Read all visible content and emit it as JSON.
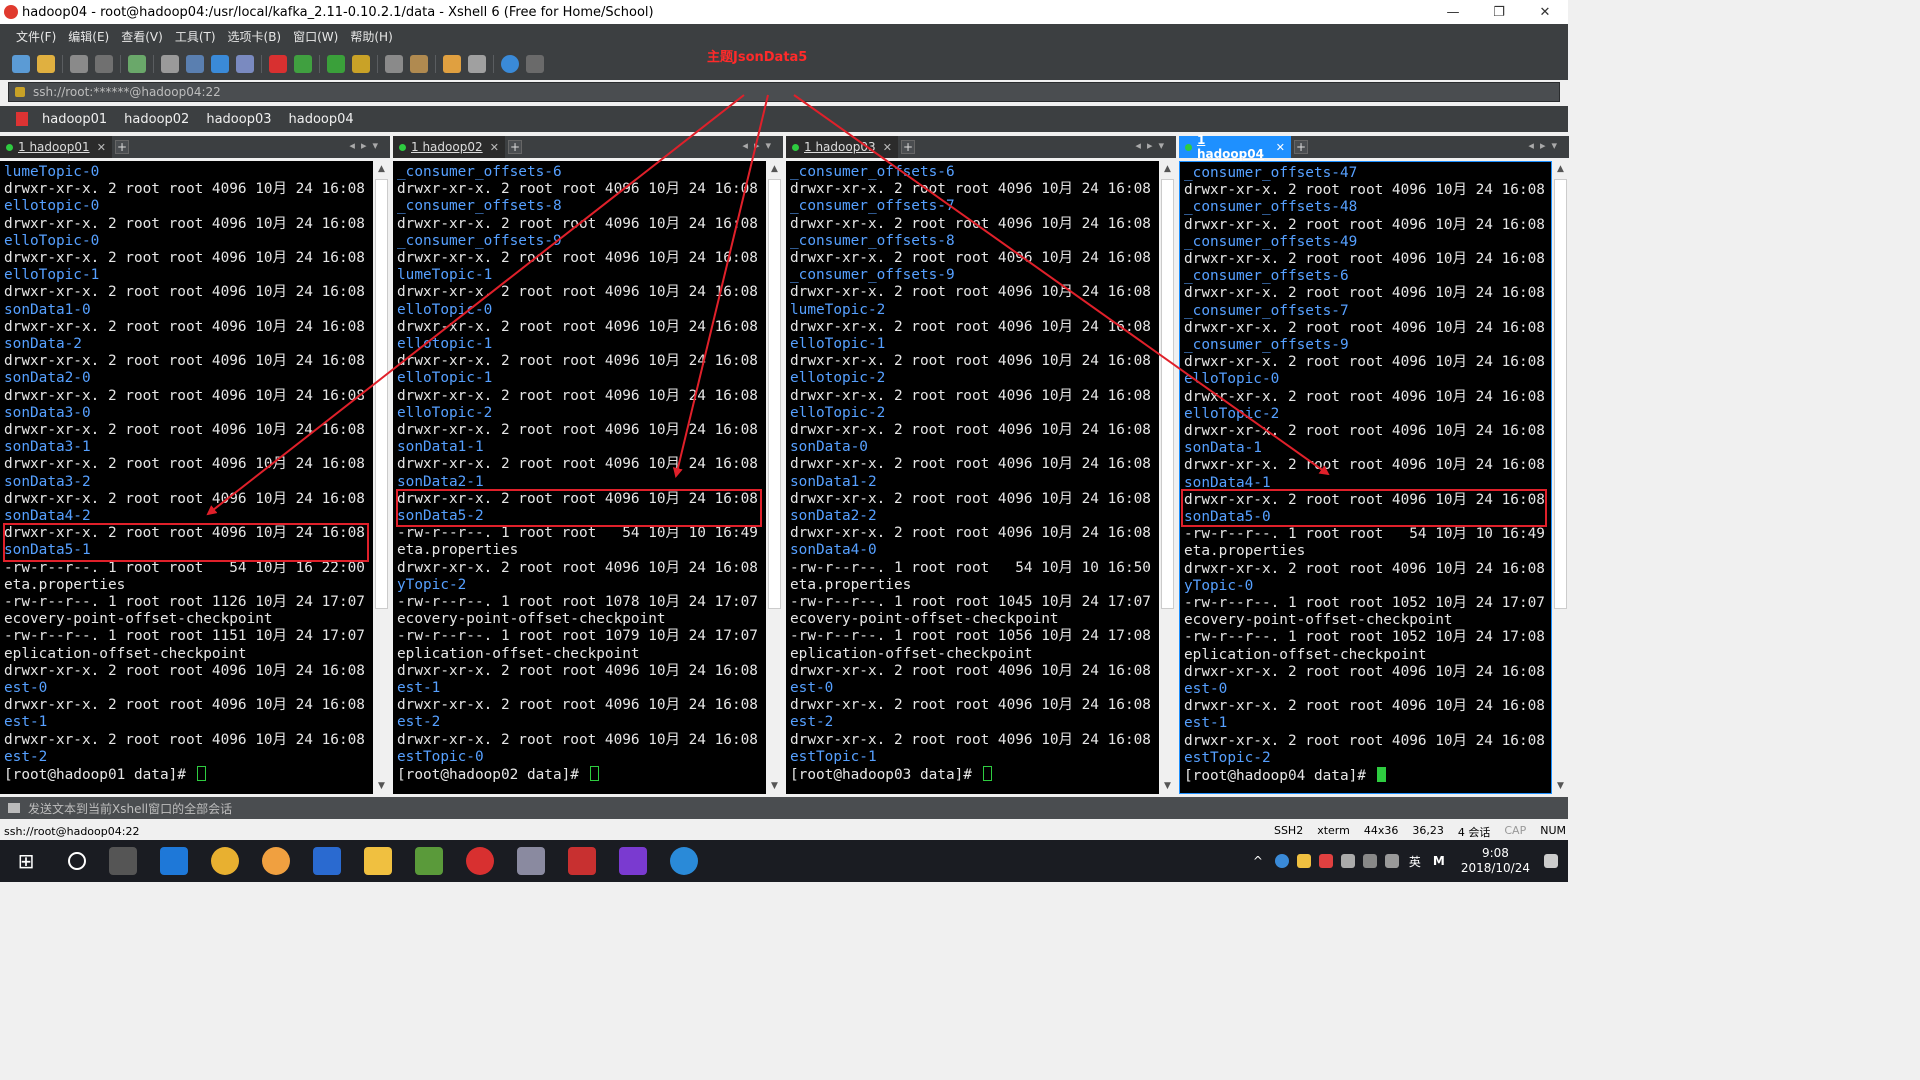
{
  "window": {
    "title": "hadoop04 - root@hadoop04:/usr/local/kafka_2.11-0.10.2.1/data - Xshell 6 (Free for Home/School)",
    "minimize": "—",
    "maximize": "❐",
    "close": "✕"
  },
  "menu": [
    "文件(F)",
    "编辑(E)",
    "查看(V)",
    "工具(T)",
    "选项卡(B)",
    "窗口(W)",
    "帮助(H)"
  ],
  "address": "ssh://root:******@hadoop04:22",
  "sessions": [
    "hadoop01",
    "hadoop02",
    "hadoop03",
    "hadoop04"
  ],
  "annotation": {
    "title": "主题JsonData5",
    "color": "#ff2a2a"
  },
  "panes": [
    {
      "tab_label": "1 hadoop01",
      "active": false,
      "lines": [
        {
          "t": "lumeTopic-0",
          "c": "blue"
        },
        {
          "t": "drwxr-xr-x. 2 root root 4096 10月 24 16:08 h"
        },
        {
          "t": "ellotopic-0",
          "c": "blue"
        },
        {
          "t": "drwxr-xr-x. 2 root root 4096 10月 24 16:08 h"
        },
        {
          "t": "elloTopic-0",
          "c": "blue"
        },
        {
          "t": "drwxr-xr-x. 2 root root 4096 10月 24 16:08 h"
        },
        {
          "t": "elloTopic-1",
          "c": "blue"
        },
        {
          "t": "drwxr-xr-x. 2 root root 4096 10月 24 16:08 J"
        },
        {
          "t": "sonData1-0",
          "c": "blue"
        },
        {
          "t": "drwxr-xr-x. 2 root root 4096 10月 24 16:08 J"
        },
        {
          "t": "sonData-2",
          "c": "blue"
        },
        {
          "t": "drwxr-xr-x. 2 root root 4096 10月 24 16:08 J"
        },
        {
          "t": "sonData2-0",
          "c": "blue"
        },
        {
          "t": "drwxr-xr-x. 2 root root 4096 10月 24 16:08 J"
        },
        {
          "t": "sonData3-0",
          "c": "blue"
        },
        {
          "t": "drwxr-xr-x. 2 root root 4096 10月 24 16:08 J"
        },
        {
          "t": "sonData3-1",
          "c": "blue"
        },
        {
          "t": "drwxr-xr-x. 2 root root 4096 10月 24 16:08 J"
        },
        {
          "t": "sonData3-2",
          "c": "blue"
        },
        {
          "t": "drwxr-xr-x. 2 root root 4096 10月 24 16:08 J"
        },
        {
          "t": "sonData4-2",
          "c": "blue"
        },
        {
          "t": "drwxr-xr-x. 2 root root 4096 10月 24 16:08 J"
        },
        {
          "t": "sonData5-1",
          "c": "blue"
        },
        {
          "t": "-rw-r--r--. 1 root root   54 10月 16 22:00 m"
        },
        {
          "t": "eta.properties"
        },
        {
          "t": "-rw-r--r--. 1 root root 1126 10月 24 17:07 r"
        },
        {
          "t": "ecovery-point-offset-checkpoint"
        },
        {
          "t": "-rw-r--r--. 1 root root 1151 10月 24 17:07 r"
        },
        {
          "t": "eplication-offset-checkpoint"
        },
        {
          "t": "drwxr-xr-x. 2 root root 4096 10月 24 16:08 t"
        },
        {
          "t": "est-0",
          "c": "blue"
        },
        {
          "t": "drwxr-xr-x. 2 root root 4096 10月 24 16:08 t"
        },
        {
          "t": "est-1",
          "c": "blue"
        },
        {
          "t": "drwxr-xr-x. 2 root root 4096 10月 24 16:08 t"
        },
        {
          "t": "est-2",
          "c": "blue"
        }
      ],
      "prompt": "[root@hadoop01 data]# "
    },
    {
      "tab_label": "1 hadoop02",
      "active": false,
      "lines": [
        {
          "t": "_consumer_offsets-6",
          "c": "blue"
        },
        {
          "t": "drwxr-xr-x. 2 root root 4096 10月 24 16:08 _"
        },
        {
          "t": "_consumer_offsets-8",
          "c": "blue"
        },
        {
          "t": "drwxr-xr-x. 2 root root 4096 10月 24 16:08 _"
        },
        {
          "t": "_consumer_offsets-9",
          "c": "blue"
        },
        {
          "t": "drwxr-xr-x. 2 root root 4096 10月 24 16:08 f"
        },
        {
          "t": "lumeTopic-1",
          "c": "blue"
        },
        {
          "t": "drwxr-xr-x. 2 root root 4096 10月 24 16:08 h"
        },
        {
          "t": "elloTopic-0",
          "c": "blue"
        },
        {
          "t": "drwxr-xr-x. 2 root root 4096 10月 24 16:08 h"
        },
        {
          "t": "ellotopic-1",
          "c": "blue"
        },
        {
          "t": "drwxr-xr-x. 2 root root 4096 10月 24 16:08 h"
        },
        {
          "t": "elloTopic-1",
          "c": "blue"
        },
        {
          "t": "drwxr-xr-x. 2 root root 4096 10月 24 16:08 h"
        },
        {
          "t": "elloTopic-2",
          "c": "blue"
        },
        {
          "t": "drwxr-xr-x. 2 root root 4096 10月 24 16:08 J"
        },
        {
          "t": "sonData1-1",
          "c": "blue"
        },
        {
          "t": "drwxr-xr-x. 2 root root 4096 10月 24 16:08 J"
        },
        {
          "t": "sonData2-1",
          "c": "blue"
        },
        {
          "t": "drwxr-xr-x. 2 root root 4096 10月 24 16:08 J"
        },
        {
          "t": "sonData5-2",
          "c": "blue"
        },
        {
          "t": "-rw-r--r--. 1 root root   54 10月 10 16:49 m"
        },
        {
          "t": "eta.properties"
        },
        {
          "t": "drwxr-xr-x. 2 root root 4096 10月 24 16:08 m"
        },
        {
          "t": "yTopic-2",
          "c": "blue"
        },
        {
          "t": "-rw-r--r--. 1 root root 1078 10月 24 17:07 r"
        },
        {
          "t": "ecovery-point-offset-checkpoint"
        },
        {
          "t": "-rw-r--r--. 1 root root 1079 10月 24 17:07 r"
        },
        {
          "t": "eplication-offset-checkpoint"
        },
        {
          "t": "drwxr-xr-x. 2 root root 4096 10月 24 16:08 t"
        },
        {
          "t": "est-1",
          "c": "blue"
        },
        {
          "t": "drwxr-xr-x. 2 root root 4096 10月 24 16:08 t"
        },
        {
          "t": "est-2",
          "c": "blue"
        },
        {
          "t": "drwxr-xr-x. 2 root root 4096 10月 24 16:08 t"
        },
        {
          "t": "estTopic-0",
          "c": "blue"
        }
      ],
      "prompt": "[root@hadoop02 data]# "
    },
    {
      "tab_label": "1 hadoop03",
      "active": false,
      "lines": [
        {
          "t": "_consumer_offsets-6",
          "c": "blue"
        },
        {
          "t": "drwxr-xr-x. 2 root root 4096 10月 24 16:08 _"
        },
        {
          "t": "_consumer_offsets-7",
          "c": "blue"
        },
        {
          "t": "drwxr-xr-x. 2 root root 4096 10月 24 16:08 _"
        },
        {
          "t": "_consumer_offsets-8",
          "c": "blue"
        },
        {
          "t": "drwxr-xr-x. 2 root root 4096 10月 24 16:08 _"
        },
        {
          "t": "_consumer_offsets-9",
          "c": "blue"
        },
        {
          "t": "drwxr-xr-x. 2 root root 4096 10月 24 16:08 f"
        },
        {
          "t": "lumeTopic-2",
          "c": "blue"
        },
        {
          "t": "drwxr-xr-x. 2 root root 4096 10月 24 16:08 h"
        },
        {
          "t": "elloTopic-1",
          "c": "blue"
        },
        {
          "t": "drwxr-xr-x. 2 root root 4096 10月 24 16:08 h"
        },
        {
          "t": "ellotopic-2",
          "c": "blue"
        },
        {
          "t": "drwxr-xr-x. 2 root root 4096 10月 24 16:08 h"
        },
        {
          "t": "elloTopic-2",
          "c": "blue"
        },
        {
          "t": "drwxr-xr-x. 2 root root 4096 10月 24 16:08 J"
        },
        {
          "t": "sonData-0",
          "c": "blue"
        },
        {
          "t": "drwxr-xr-x. 2 root root 4096 10月 24 16:08 J"
        },
        {
          "t": "sonData1-2",
          "c": "blue"
        },
        {
          "t": "drwxr-xr-x. 2 root root 4096 10月 24 16:08 J"
        },
        {
          "t": "sonData2-2",
          "c": "blue"
        },
        {
          "t": "drwxr-xr-x. 2 root root 4096 10月 24 16:08 J"
        },
        {
          "t": "sonData4-0",
          "c": "blue"
        },
        {
          "t": "-rw-r--r--. 1 root root   54 10月 10 16:50 m"
        },
        {
          "t": "eta.properties"
        },
        {
          "t": "-rw-r--r--. 1 root root 1045 10月 24 17:07 r"
        },
        {
          "t": "ecovery-point-offset-checkpoint"
        },
        {
          "t": "-rw-r--r--. 1 root root 1056 10月 24 17:08 r"
        },
        {
          "t": "eplication-offset-checkpoint"
        },
        {
          "t": "drwxr-xr-x. 2 root root 4096 10月 24 16:08 t"
        },
        {
          "t": "est-0",
          "c": "blue"
        },
        {
          "t": "drwxr-xr-x. 2 root root 4096 10月 24 16:08 t"
        },
        {
          "t": "est-2",
          "c": "blue"
        },
        {
          "t": "drwxr-xr-x. 2 root root 4096 10月 24 16:08 t"
        },
        {
          "t": "estTopic-1",
          "c": "blue"
        }
      ],
      "prompt": "[root@hadoop03 data]# "
    },
    {
      "tab_label": "1 hadoop04",
      "active": true,
      "lines": [
        {
          "t": "_consumer_offsets-47",
          "c": "blue"
        },
        {
          "t": "drwxr-xr-x. 2 root root 4096 10月 24 16:08 _"
        },
        {
          "t": "_consumer_offsets-48",
          "c": "blue"
        },
        {
          "t": "drwxr-xr-x. 2 root root 4096 10月 24 16:08 _"
        },
        {
          "t": "_consumer_offsets-49",
          "c": "blue"
        },
        {
          "t": "drwxr-xr-x. 2 root root 4096 10月 24 16:08 _"
        },
        {
          "t": "_consumer_offsets-6",
          "c": "blue"
        },
        {
          "t": "drwxr-xr-x. 2 root root 4096 10月 24 16:08 _"
        },
        {
          "t": "_consumer_offsets-7",
          "c": "blue"
        },
        {
          "t": "drwxr-xr-x. 2 root root 4096 10月 24 16:08 _"
        },
        {
          "t": "_consumer_offsets-9",
          "c": "blue"
        },
        {
          "t": "drwxr-xr-x. 2 root root 4096 10月 24 16:08 h"
        },
        {
          "t": "elloTopic-0",
          "c": "blue"
        },
        {
          "t": "drwxr-xr-x. 2 root root 4096 10月 24 16:08 h"
        },
        {
          "t": "elloTopic-2",
          "c": "blue"
        },
        {
          "t": "drwxr-xr-x. 2 root root 4096 10月 24 16:08 J"
        },
        {
          "t": "sonData-1",
          "c": "blue"
        },
        {
          "t": "drwxr-xr-x. 2 root root 4096 10月 24 16:08 J"
        },
        {
          "t": "sonData4-1",
          "c": "blue"
        },
        {
          "t": "drwxr-xr-x. 2 root root 4096 10月 24 16:08 J"
        },
        {
          "t": "sonData5-0",
          "c": "blue"
        },
        {
          "t": "-rw-r--r--. 1 root root   54 10月 10 16:49 m"
        },
        {
          "t": "eta.properties"
        },
        {
          "t": "drwxr-xr-x. 2 root root 4096 10月 24 16:08 m"
        },
        {
          "t": "yTopic-0",
          "c": "blue"
        },
        {
          "t": "-rw-r--r--. 1 root root 1052 10月 24 17:07 r"
        },
        {
          "t": "ecovery-point-offset-checkpoint"
        },
        {
          "t": "-rw-r--r--. 1 root root 1052 10月 24 17:08 r"
        },
        {
          "t": "eplication-offset-checkpoint"
        },
        {
          "t": "drwxr-xr-x. 2 root root 4096 10月 24 16:08 t"
        },
        {
          "t": "est-0",
          "c": "blue"
        },
        {
          "t": "drwxr-xr-x. 2 root root 4096 10月 24 16:08 t"
        },
        {
          "t": "est-1",
          "c": "blue"
        },
        {
          "t": "drwxr-xr-x. 2 root root 4096 10月 24 16:08 t"
        },
        {
          "t": "estTopic-2",
          "c": "blue"
        }
      ],
      "prompt": "[root@hadoop04 data]# "
    }
  ],
  "send_bar": "发送文本到当前Xshell窗口的全部会话",
  "status": {
    "left": "ssh://root@hadoop04:22",
    "protocol": "SSH2",
    "term": "xterm",
    "size": "44x36",
    "pos": "36,23",
    "sessions": "4 会话",
    "caps": "CAP",
    "num": "NUM"
  },
  "taskbar": {
    "time": "9:08",
    "date": "2018/10/24",
    "ime": "英",
    "ime2": "M"
  }
}
